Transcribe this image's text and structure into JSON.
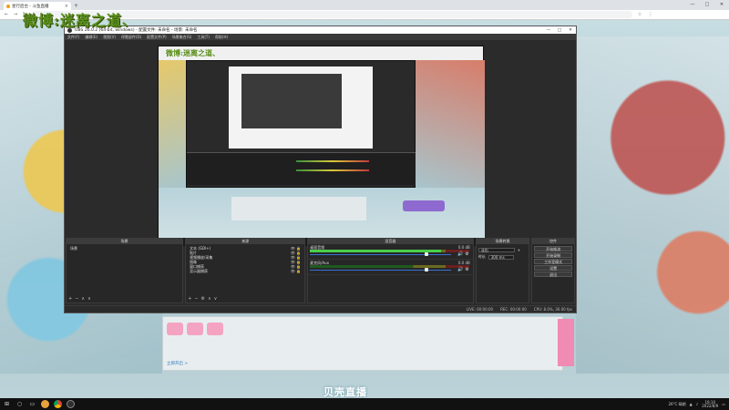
{
  "browser": {
    "tab_title": "星行后台 - 斗鱼直播",
    "tab_close": "×",
    "new_tab": "+",
    "controls": [
      "—",
      "□",
      "✕"
    ],
    "nav": [
      "←",
      "→",
      "↻"
    ],
    "url": "",
    "tools": [
      "☆",
      "⋮"
    ]
  },
  "overlay": {
    "watermark": "微博:迷离之道、"
  },
  "stream_page": {
    "title": "贝壳直播",
    "link_text": "立即开启 >"
  },
  "obs": {
    "title": "OBS 26.0.2 (64-bit, windows) - 配置文件: 未命名 - 场景: 未命名",
    "controls": [
      "—",
      "□",
      "✕"
    ],
    "menu": [
      "文件(F)",
      "编辑(E)",
      "视图(V)",
      "停靠部件(D)",
      "配置文件(P)",
      "场景集合(S)",
      "工具(T)",
      "帮助(H)"
    ],
    "preview": {
      "watermark": "微博:迷离之道、"
    },
    "docks": {
      "scenes": {
        "title": "场景",
        "items": [
          "场景"
        ],
        "footer": [
          "+",
          "−",
          "∧",
          "∨"
        ]
      },
      "sources": {
        "title": "来源",
        "items": [
          {
            "label": "文本 (GDI+)",
            "icons": "👁 🔒"
          },
          {
            "label": "贴片",
            "icons": "👁 🔒"
          },
          {
            "label": "视频播放/采集",
            "icons": "👁 🔒"
          },
          {
            "label": "图像",
            "icons": "👁 🔒"
          },
          {
            "label": "窗口捕获",
            "icons": "👁 🔒"
          },
          {
            "label": "显示器捕获",
            "icons": "👁 🔒"
          }
        ],
        "footer": [
          "+",
          "−",
          "⚙",
          "∧",
          "∨"
        ]
      },
      "mixer": {
        "title": "混音器",
        "channels": [
          {
            "name": "桌面音频",
            "db": "0.0 dB",
            "level": 0.82
          },
          {
            "name": "麦克风/Aux",
            "db": "0.0 dB",
            "level": 0.0
          }
        ]
      },
      "transitions": {
        "title": "场景转换",
        "type_label": "淡出",
        "duration_label": "时长",
        "duration_value": "300 ms"
      },
      "controls": {
        "title": "控件",
        "buttons": [
          "开始推流",
          "开始录制",
          "工作室模式",
          "设置",
          "退出"
        ]
      }
    },
    "status": [
      "LIVE: 00:00:00",
      "REC: 00:00:00",
      "CPU: 8.0%, 30.00 fps"
    ]
  },
  "taskbar": {
    "start": "⊞",
    "search": "○",
    "taskview": "▭",
    "weather": "26°C 晴朗",
    "time": "19:10",
    "date": "2022/8/9"
  }
}
